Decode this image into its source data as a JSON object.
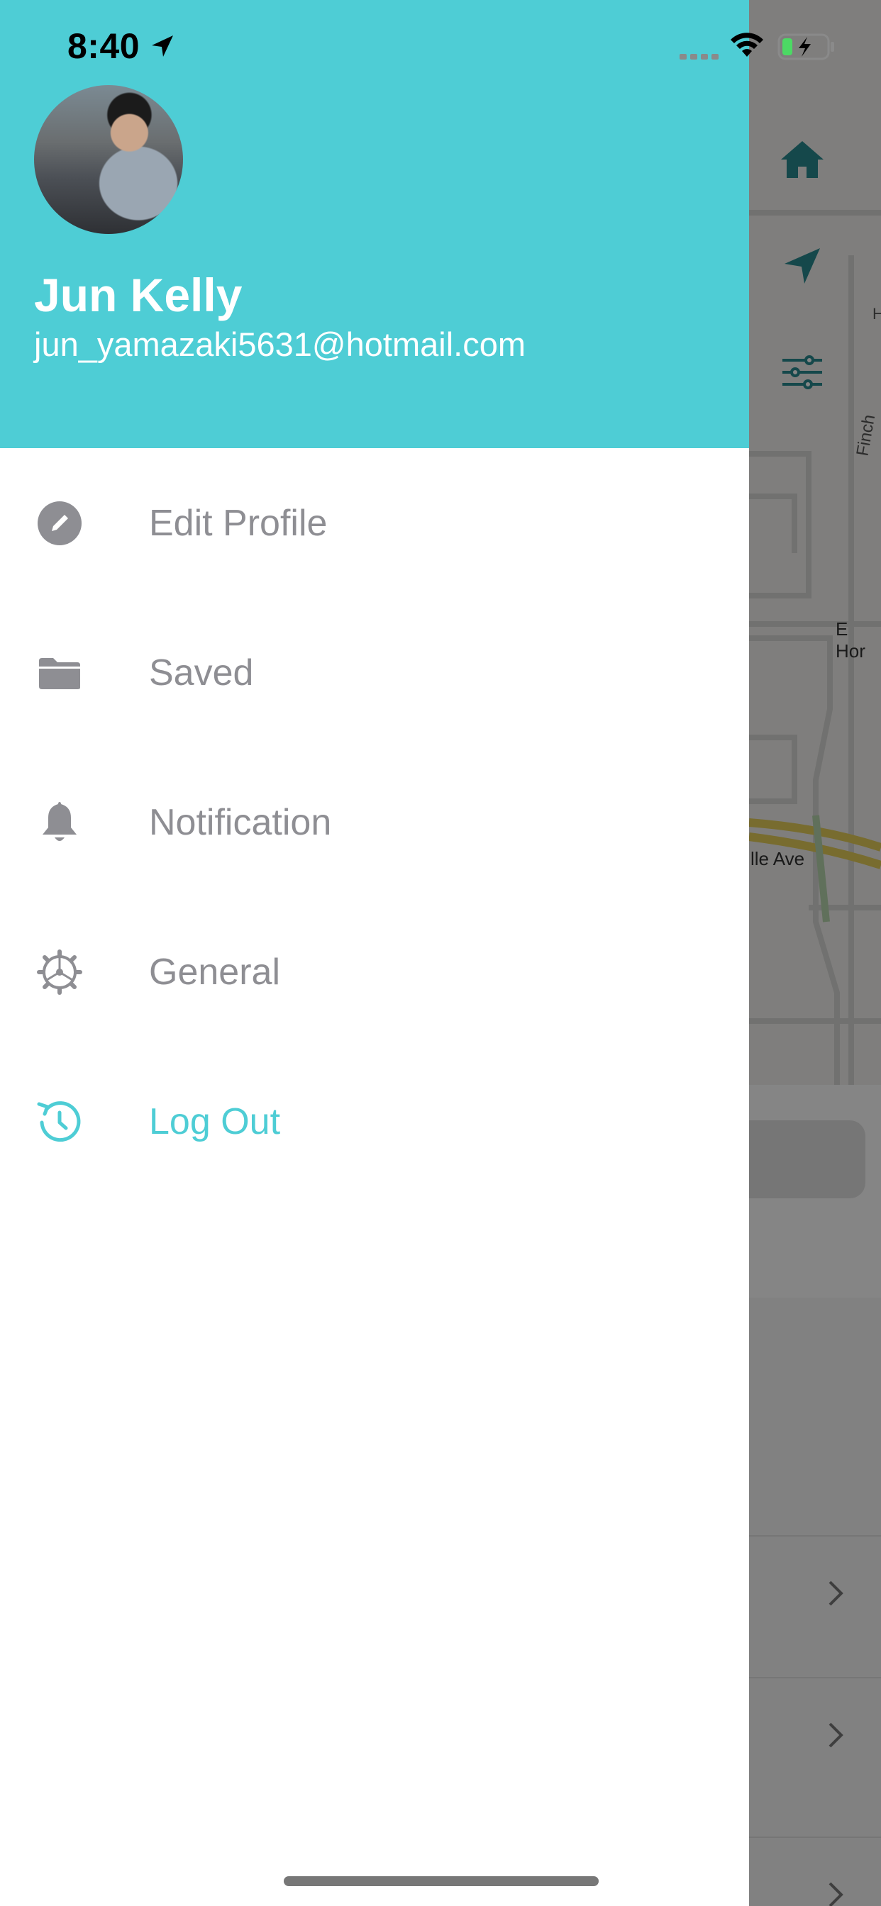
{
  "status_bar": {
    "time": "8:40",
    "icons": [
      "location-arrow-icon",
      "signal-icon",
      "wifi-icon",
      "battery-charging-icon"
    ]
  },
  "background": {
    "map_labels": [
      "Finch",
      "E Hor",
      "lle Ave",
      "H"
    ],
    "toolbar_icons": [
      "home-icon",
      "navigation-arrow-icon",
      "filter-sliders-icon"
    ],
    "accent_color": "#2a8a90"
  },
  "drawer": {
    "user": {
      "name": "Jun Kelly",
      "email": "jun_yamazaki5631@hotmail.com"
    },
    "menu": [
      {
        "label": "Edit Profile",
        "icon": "edit-pencil-icon"
      },
      {
        "label": "Saved",
        "icon": "folder-icon"
      },
      {
        "label": "Notification",
        "icon": "bell-icon"
      },
      {
        "label": "General",
        "icon": "gear-icon"
      },
      {
        "label": "Log Out",
        "icon": "logout-icon"
      }
    ],
    "header_color": "#4ecdd5",
    "menu_text_color": "#8e8e93",
    "accent_color": "#4ecdd5"
  }
}
